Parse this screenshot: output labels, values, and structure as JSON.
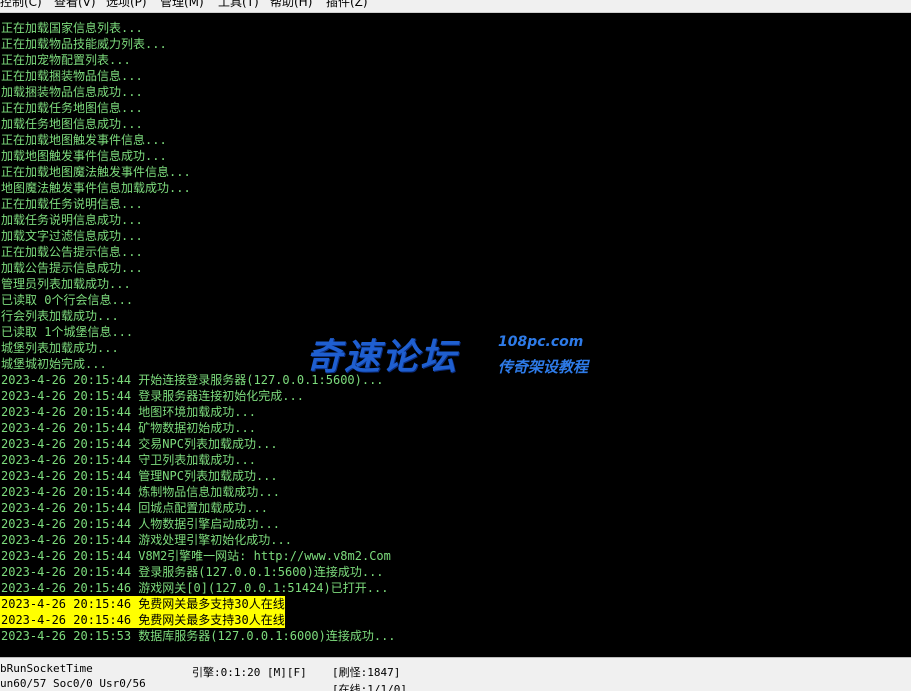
{
  "menubar": {
    "items": [
      "控制(C)",
      "查看(V)",
      "选项(P)",
      "管理(M)",
      "工具(T)",
      "帮助(H)",
      "插件(Z)"
    ]
  },
  "console": {
    "lines": [
      {
        "text": "正在加载国家信息列表...",
        "highlight": false
      },
      {
        "text": "正在加载物品技能威力列表...",
        "highlight": false
      },
      {
        "text": "正在加宠物配置列表...",
        "highlight": false
      },
      {
        "text": "正在加载捆装物品信息...",
        "highlight": false
      },
      {
        "text": "加载捆装物品信息成功...",
        "highlight": false
      },
      {
        "text": "正在加载任务地图信息...",
        "highlight": false
      },
      {
        "text": "加载任务地图信息成功...",
        "highlight": false
      },
      {
        "text": "正在加载地图触发事件信息...",
        "highlight": false
      },
      {
        "text": "加载地图触发事件信息成功...",
        "highlight": false
      },
      {
        "text": "正在加载地图魔法触发事件信息...",
        "highlight": false
      },
      {
        "text": "地图魔法触发事件信息加载成功...",
        "highlight": false
      },
      {
        "text": "正在加载任务说明信息...",
        "highlight": false
      },
      {
        "text": "加载任务说明信息成功...",
        "highlight": false
      },
      {
        "text": "加载文字过滤信息成功...",
        "highlight": false
      },
      {
        "text": "正在加载公告提示信息...",
        "highlight": false
      },
      {
        "text": "加载公告提示信息成功...",
        "highlight": false
      },
      {
        "text": "管理员列表加载成功...",
        "highlight": false
      },
      {
        "text": "已读取 0个行会信息...",
        "highlight": false
      },
      {
        "text": "行会列表加载成功...",
        "highlight": false
      },
      {
        "text": "已读取 1个城堡信息...",
        "highlight": false
      },
      {
        "text": "城堡列表加载成功...",
        "highlight": false
      },
      {
        "text": "城堡城初始完成...",
        "highlight": false
      },
      {
        "text": "2023-4-26 20:15:44 开始连接登录服务器(127.0.0.1:5600)...",
        "highlight": false
      },
      {
        "text": "2023-4-26 20:15:44 登录服务器连接初始化完成...",
        "highlight": false
      },
      {
        "text": "2023-4-26 20:15:44 地图环境加载成功...",
        "highlight": false
      },
      {
        "text": "2023-4-26 20:15:44 矿物数据初始成功...",
        "highlight": false
      },
      {
        "text": "2023-4-26 20:15:44 交易NPC列表加载成功...",
        "highlight": false
      },
      {
        "text": "2023-4-26 20:15:44 守卫列表加载成功...",
        "highlight": false
      },
      {
        "text": "2023-4-26 20:15:44 管理NPC列表加载成功...",
        "highlight": false
      },
      {
        "text": "2023-4-26 20:15:44 炼制物品信息加载成功...",
        "highlight": false
      },
      {
        "text": "2023-4-26 20:15:44 回城点配置加载成功...",
        "highlight": false
      },
      {
        "text": "2023-4-26 20:15:44 人物数据引擎启动成功...",
        "highlight": false
      },
      {
        "text": "2023-4-26 20:15:44 游戏处理引擎初始化成功...",
        "highlight": false
      },
      {
        "text": "2023-4-26 20:15:44 V8M2引擎唯一网站: http://www.v8m2.Com",
        "highlight": false
      },
      {
        "text": "2023-4-26 20:15:44 登录服务器(127.0.0.1:5600)连接成功...",
        "highlight": false
      },
      {
        "text": "2023-4-26 20:15:46 游戏网关[0](127.0.0.1:51424)已打开...",
        "highlight": false
      },
      {
        "text": "2023-4-26 20:15:46 免费网关最多支持30人在线",
        "highlight": true
      },
      {
        "text": "2023-4-26 20:15:46 免费网关最多支持30人在线",
        "highlight": true
      },
      {
        "text": "2023-4-26 20:15:53 数据库服务器(127.0.0.1:6000)连接成功...",
        "highlight": false
      }
    ]
  },
  "watermark": {
    "main": "奇速论坛",
    "domain": "108pc.com",
    "sub": "传奇架设教程"
  },
  "statusbar": {
    "run_socket_time": "bRunSocketTime",
    "counts": "un60/57 Soc0/0 Usr0/56",
    "engine": "引擎:0:1:20 [M][F]",
    "refresh_monster": "[刷怪:1847]",
    "online": "[在线:1/1/0]"
  },
  "colors": {
    "console_text": "#7ddc7d",
    "highlight_bg": "#ffff00",
    "watermark_blue": "#1f5fd0"
  }
}
